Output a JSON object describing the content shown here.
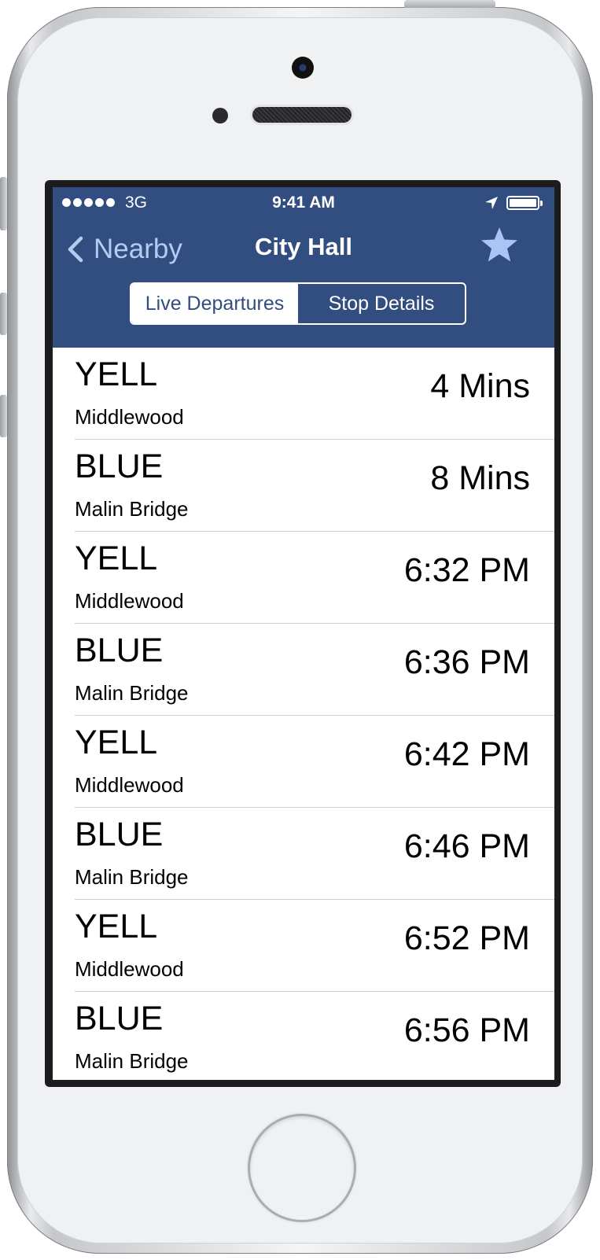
{
  "status_bar": {
    "carrier": "3G",
    "time": "9:41 AM",
    "signal_bars": 5,
    "icons": [
      "signal-dots",
      "location-arrow-icon",
      "battery-icon"
    ]
  },
  "nav": {
    "back_label": "Nearby",
    "title": "City Hall",
    "favorite_icon": "star-icon"
  },
  "segments": {
    "items": [
      {
        "label": "Live Departures",
        "selected": true
      },
      {
        "label": "Stop Details",
        "selected": false
      }
    ]
  },
  "departures": [
    {
      "route": "YELL",
      "destination": "Middlewood",
      "due": "4 Mins"
    },
    {
      "route": "BLUE",
      "destination": "Malin Bridge",
      "due": "8 Mins"
    },
    {
      "route": "YELL",
      "destination": "Middlewood",
      "due": "6:32 PM"
    },
    {
      "route": "BLUE",
      "destination": "Malin Bridge",
      "due": "6:36 PM"
    },
    {
      "route": "YELL",
      "destination": "Middlewood",
      "due": "6:42 PM"
    },
    {
      "route": "BLUE",
      "destination": "Malin Bridge",
      "due": "6:46 PM"
    },
    {
      "route": "YELL",
      "destination": "Middlewood",
      "due": "6:52 PM"
    },
    {
      "route": "BLUE",
      "destination": "Malin Bridge",
      "due": "6:56 PM"
    }
  ],
  "colors": {
    "nav_background": "#324d7f",
    "back_tint": "#b4ccf2",
    "star_fill": "#a9c4f5",
    "separator": "#cfcfd3"
  }
}
